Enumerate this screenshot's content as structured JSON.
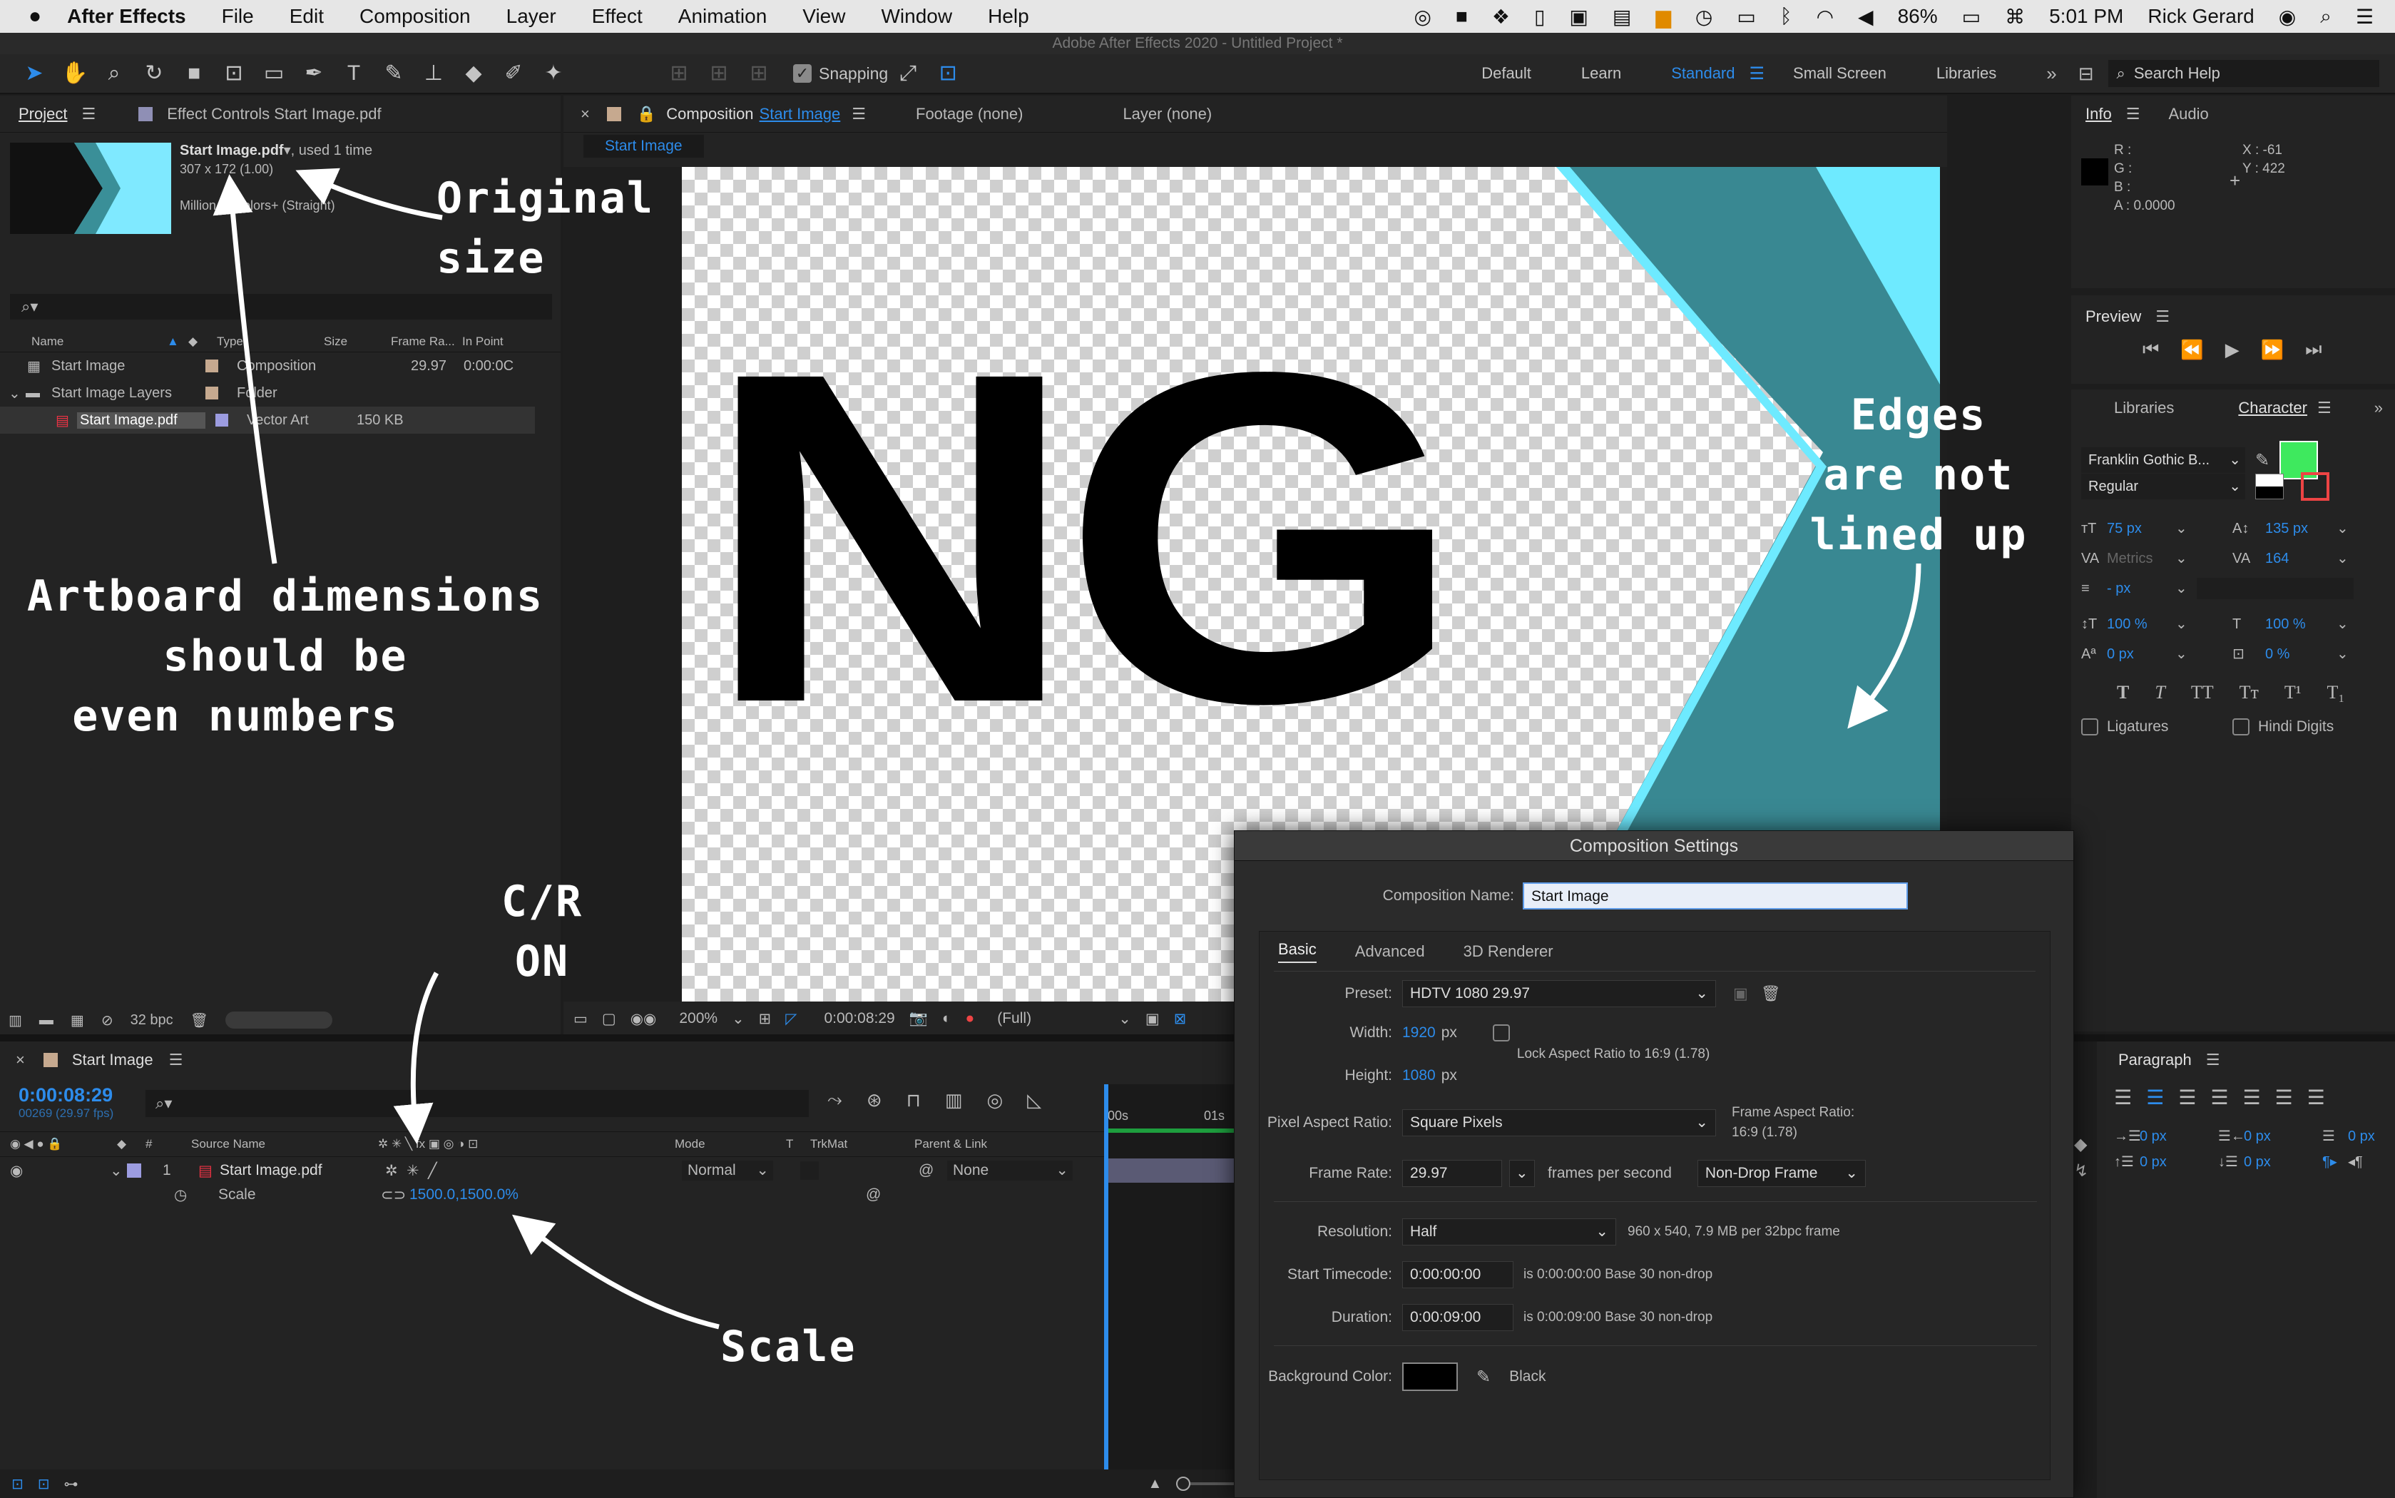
{
  "menubar": {
    "app": "After Effects",
    "items": [
      "File",
      "Edit",
      "Composition",
      "Layer",
      "Effect",
      "Animation",
      "View",
      "Window",
      "Help"
    ],
    "battery": "86%",
    "time": "5:01 PM",
    "user": "Rick Gerard"
  },
  "window_title": "Adobe After Effects 2020 - Untitled Project *",
  "toolbar": {
    "snapping_label": "Snapping",
    "workspaces": [
      "Default",
      "Learn",
      "Standard",
      "Small Screen",
      "Libraries"
    ],
    "active_workspace": "Standard",
    "search_placeholder": "Search Help"
  },
  "project_panel": {
    "tab": "Project",
    "effect_tab": "Effect Controls Start Image.pdf",
    "item_name": "Start Image.pdf",
    "item_used": ", used 1 time",
    "item_size": "307 x 172 (1.00)",
    "item_colors": "Million of Colors+ (Straight)",
    "columns": [
      "Name",
      "Type",
      "Size",
      "Frame Ra...",
      "In Point"
    ],
    "rows": [
      {
        "name": "Start Image",
        "type": "Composition",
        "size": "",
        "fps": "29.97",
        "inpoint": "0:00:0C"
      },
      {
        "name": "Start Image Layers",
        "type": "Folder",
        "size": "",
        "fps": "",
        "inpoint": ""
      },
      {
        "name": "Start Image.pdf",
        "type": "Vector Art",
        "size": "150 KB",
        "fps": "",
        "inpoint": ""
      }
    ],
    "bpc": "32 bpc"
  },
  "comp_panel": {
    "tab_prefix": "Composition",
    "tab_comp": "Start Image",
    "footage_tab": "Footage (none)",
    "layer_tab": "Layer (none)",
    "breadcrumb": "Start Image",
    "canvas_text": "NG",
    "zoom": "200%",
    "timecode": "0:00:08:29",
    "resolution": "(Full)"
  },
  "timeline": {
    "tab": "Start Image",
    "timecode": "0:00:08:29",
    "frames": "00269 (29.97 fps)",
    "columns": [
      "#",
      "Source Name",
      "Mode",
      "T",
      "TrkMat",
      "Parent & Link"
    ],
    "layer_num": "1",
    "layer_name": "Start Image.pdf",
    "layer_mode": "Normal",
    "layer_parent": "None",
    "prop_name": "Scale",
    "prop_value": "1500.0,1500.0%",
    "ruler": [
      ":00s",
      "01s"
    ]
  },
  "info_panel": {
    "tab": "Info",
    "audio_tab": "Audio",
    "r": "R :",
    "g": "G :",
    "b": "B :",
    "a": "A :  0.0000",
    "x": "X : -61",
    "y": "Y : 422"
  },
  "preview_panel": {
    "title": "Preview"
  },
  "character_panel": {
    "libraries_tab": "Libraries",
    "tab": "Character",
    "font": "Franklin Gothic B...",
    "style": "Regular",
    "size": "75 px",
    "leading": "135 px",
    "kerning": "Metrics",
    "tracking": "164",
    "stroke": "- px",
    "vscale": "100 %",
    "hscale": "100 %",
    "baseline": "0 px",
    "tsume": "0 %",
    "ligatures": "Ligatures",
    "hindi": "Hindi Digits",
    "fill_color": "#3ee95e"
  },
  "paragraph_panel": {
    "tab": "Paragraph",
    "indent_left": "0 px",
    "indent_right": "0 px",
    "indent_first": "0 px",
    "space_before": "0 px",
    "space_after": "0 px"
  },
  "dialog": {
    "title": "Composition Settings",
    "name_label": "Composition Name:",
    "name_value": "Start Image",
    "tabs": [
      "Basic",
      "Advanced",
      "3D Renderer"
    ],
    "preset_label": "Preset:",
    "preset_value": "HDTV 1080 29.97",
    "width_label": "Width:",
    "width_value": "1920",
    "height_label": "Height:",
    "height_value": "1080",
    "px": "px",
    "lock_label": "Lock Aspect Ratio to 16:9 (1.78)",
    "par_label": "Pixel Aspect Ratio:",
    "par_value": "Square Pixels",
    "far_label": "Frame Aspect Ratio:",
    "far_value": "16:9 (1.78)",
    "fps_label": "Frame Rate:",
    "fps_value": "29.97",
    "fps_unit": "frames per second",
    "drop_value": "Non-Drop Frame",
    "res_label": "Resolution:",
    "res_value": "Half",
    "res_info": "960 x 540, 7.9 MB per 32bpc frame",
    "start_label": "Start Timecode:",
    "start_value": "0:00:00:00",
    "start_info": "is 0:00:00:00  Base 30  non-drop",
    "dur_label": "Duration:",
    "dur_value": "0:00:09:00",
    "dur_info": "is 0:00:09:00  Base 30  non-drop",
    "bg_label": "Background Color:",
    "bg_name": "Black"
  },
  "annotations": {
    "original_size": [
      "Original",
      "size"
    ],
    "artboard": [
      "Artboard dimensions",
      "should be",
      "even numbers"
    ],
    "edges": [
      "Edges",
      "are not",
      "lined up"
    ],
    "cr": [
      "C/R",
      "ON"
    ],
    "scale": "Scale"
  }
}
